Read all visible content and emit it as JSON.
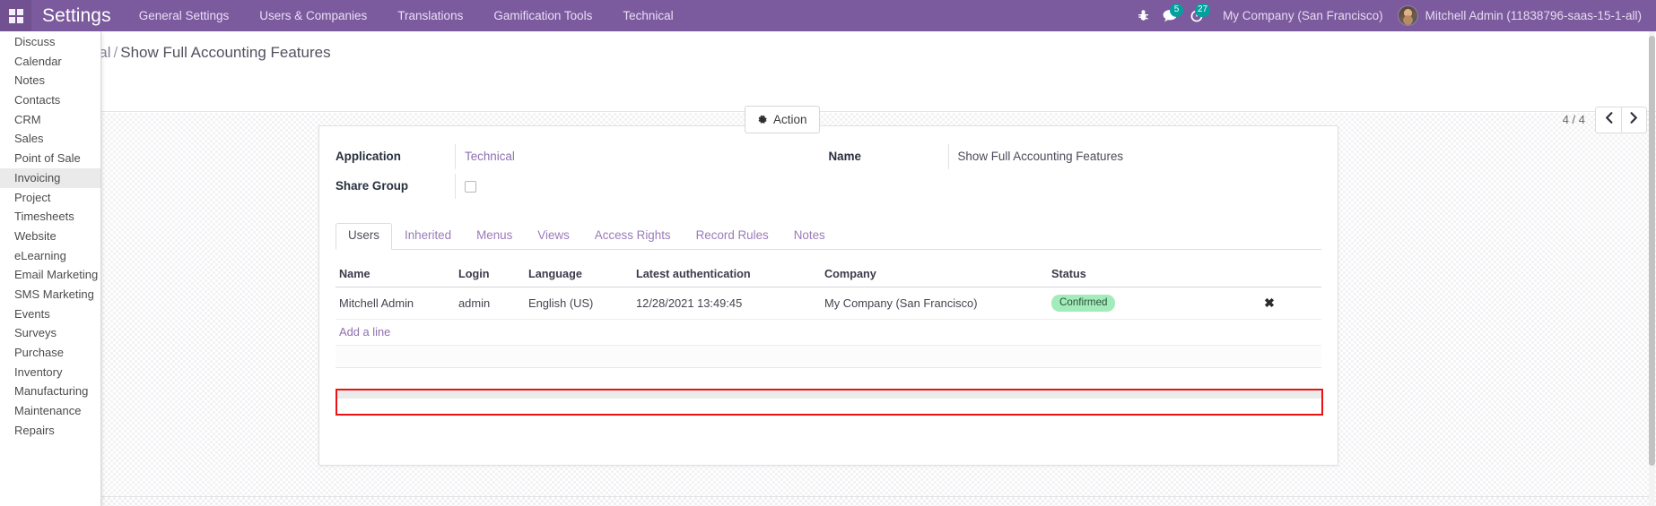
{
  "topbar": {
    "apps_icon": "apps-grid-icon",
    "brand": "Settings",
    "menu": [
      {
        "label": "General Settings"
      },
      {
        "label": "Users & Companies"
      },
      {
        "label": "Translations"
      },
      {
        "label": "Gamification Tools"
      },
      {
        "label": "Technical"
      }
    ],
    "systray": {
      "debug_icon": "bug-icon",
      "messages_icon": "messages-icon",
      "messages_count": "5",
      "activities_icon": "clock-icon",
      "activities_count": "27"
    },
    "company": "My Company (San Francisco)",
    "user": "Mitchell Admin (11838796-saas-15-1-all)",
    "avatar": "user-avatar",
    "accent": "#7c5a9e"
  },
  "app_dropdown": {
    "items": [
      {
        "label": "Discuss",
        "active": false
      },
      {
        "label": "Calendar",
        "active": false
      },
      {
        "label": "Notes",
        "active": false
      },
      {
        "label": "Contacts",
        "active": false
      },
      {
        "label": "CRM",
        "active": false
      },
      {
        "label": "Sales",
        "active": false
      },
      {
        "label": "Point of Sale",
        "active": false
      },
      {
        "label": "Invoicing",
        "active": true
      },
      {
        "label": "Project",
        "active": false
      },
      {
        "label": "Timesheets",
        "active": false
      },
      {
        "label": "Website",
        "active": false
      },
      {
        "label": "eLearning",
        "active": false
      },
      {
        "label": "Email Marketing",
        "active": false
      },
      {
        "label": "SMS Marketing",
        "active": false
      },
      {
        "label": "Events",
        "active": false
      },
      {
        "label": "Surveys",
        "active": false
      },
      {
        "label": "Purchase",
        "active": false
      },
      {
        "label": "Inventory",
        "active": false
      },
      {
        "label": "Manufacturing",
        "active": false
      },
      {
        "label": "Maintenance",
        "active": false
      },
      {
        "label": "Repairs",
        "active": false
      }
    ]
  },
  "control_panel": {
    "breadcrumb_parent": "ical",
    "breadcrumb_sep": "/",
    "breadcrumb_current": "Show Full Accounting Features",
    "action_label": "Action",
    "action_icon": "gear-icon",
    "pager_count": "4 / 4",
    "prev_icon": "chevron-left-icon",
    "next_icon": "chevron-right-icon"
  },
  "form": {
    "left": [
      {
        "label": "Application",
        "value": "Technical",
        "type": "link",
        "name": "application"
      },
      {
        "label": "Share Group",
        "value": "",
        "type": "checkbox",
        "name": "share-group"
      }
    ],
    "right": [
      {
        "label": "Name",
        "value": "Show Full Accounting Features",
        "type": "text",
        "name": "name"
      }
    ]
  },
  "notebook": {
    "tabs": [
      {
        "label": "Users",
        "active": true
      },
      {
        "label": "Inherited",
        "active": false
      },
      {
        "label": "Menus",
        "active": false
      },
      {
        "label": "Views",
        "active": false
      },
      {
        "label": "Access Rights",
        "active": false
      },
      {
        "label": "Record Rules",
        "active": false
      },
      {
        "label": "Notes",
        "active": false
      }
    ],
    "table": {
      "columns": [
        "Name",
        "Login",
        "Language",
        "Latest authentication",
        "Company",
        "Status",
        ""
      ],
      "rows": [
        {
          "name": "Mitchell Admin",
          "login": "admin",
          "language": "English (US)",
          "latest_authentication": "12/28/2021 13:49:45",
          "company": "My Company (San Francisco)",
          "status": "Confirmed",
          "status_color": "#a2ecba",
          "delete_icon": "close-icon"
        }
      ],
      "add_line_label": "Add a line"
    }
  }
}
